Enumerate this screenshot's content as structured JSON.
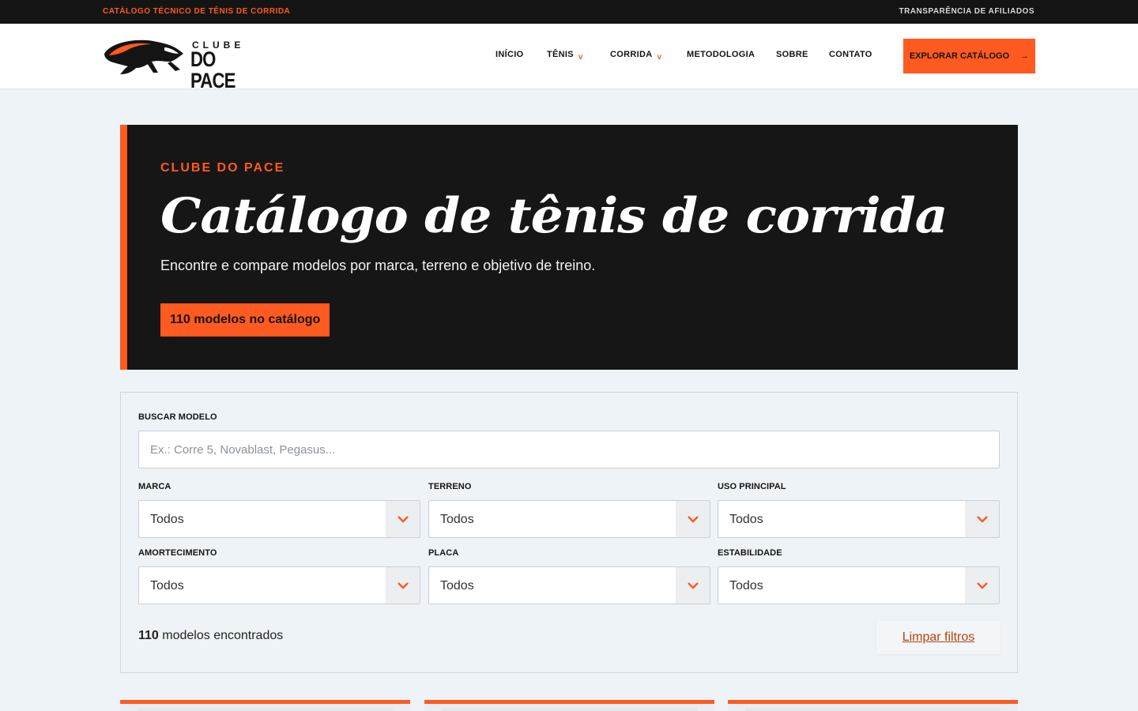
{
  "topbar": {
    "left": "CATÁLOGO TÉCNICO DE TÊNIS DE CORRIDA",
    "right": "TRANSPARÊNCIA DE AFILIADOS"
  },
  "logo": {
    "line1": "CLUBE",
    "line2": "DO PACE"
  },
  "nav": {
    "items": [
      {
        "label": "INÍCIO",
        "dropdown": false
      },
      {
        "label": "TÊNIS",
        "dropdown": true
      },
      {
        "label": "CORRIDA",
        "dropdown": true
      },
      {
        "label": "METODOLOGIA",
        "dropdown": false
      },
      {
        "label": "SOBRE",
        "dropdown": false
      },
      {
        "label": "CONTATO",
        "dropdown": false
      }
    ],
    "caret": "v",
    "cta_label": "EXPLORAR CATÁLOGO",
    "cta_arrow": "→"
  },
  "hero": {
    "eyebrow": "CLUBE DO PACE",
    "title": "Catálogo de tênis de corrida",
    "subtitle": "Encontre e compare modelos por marca, terreno e objetivo de treino.",
    "badge": "110 modelos no catálogo"
  },
  "filters": {
    "search_label": "BUSCAR MODELO",
    "search_placeholder": "Ex.: Corre 5, Novablast, Pegasus...",
    "selects": [
      {
        "label": "MARCA",
        "value": "Todos"
      },
      {
        "label": "TERRENO",
        "value": "Todos"
      },
      {
        "label": "USO PRINCIPAL",
        "value": "Todos"
      },
      {
        "label": "AMORTECIMENTO",
        "value": "Todos"
      },
      {
        "label": "PLACA",
        "value": "Todos"
      },
      {
        "label": "ESTABILIDADE",
        "value": "Todos"
      }
    ],
    "count_number": "110",
    "count_text": "modelos encontrados",
    "clear_label": "Limpar filtros"
  },
  "colors": {
    "accent": "#ff5a1f",
    "dark": "#141414",
    "background": "#eef3f7"
  }
}
